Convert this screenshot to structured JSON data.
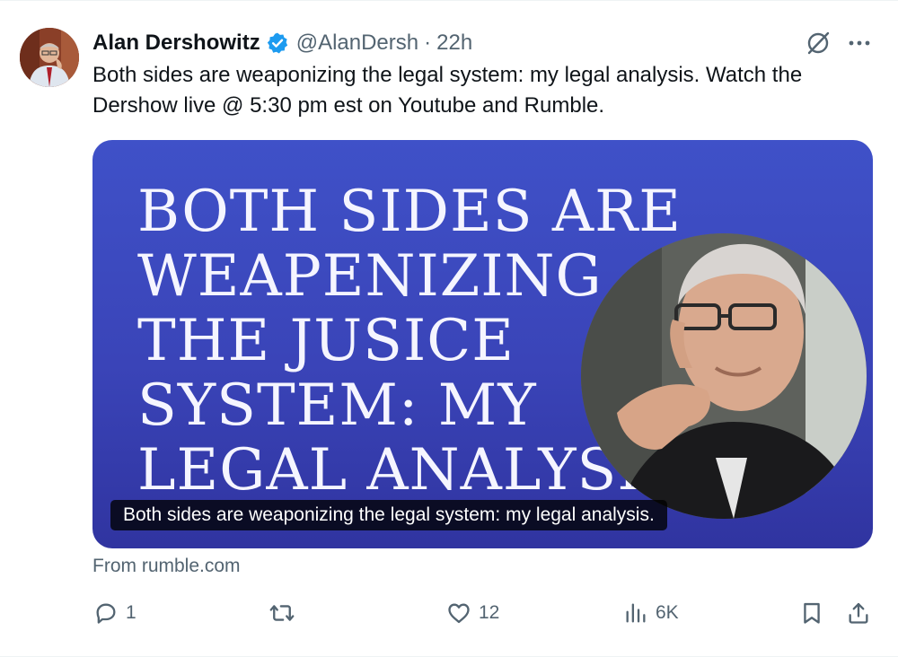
{
  "author": {
    "name": "Alan Dershowitz",
    "handle": "@AlanDersh",
    "separator": "·",
    "time": "22h"
  },
  "tweet": {
    "text": "Both sides are weaponizing the legal system: my legal analysis. Watch the Dershow live @ 5:30 pm est on Youtube and Rumble."
  },
  "card": {
    "title_lines": [
      "BOTH SIDES ARE",
      "WEAPENIZING",
      "THE JUSICE",
      "SYSTEM: MY",
      "LEGAL ANALYSIS."
    ],
    "caption": "Both sides are weaponizing the legal system: my legal analysis.",
    "source": "From rumble.com"
  },
  "actions": {
    "replies": "1",
    "reposts": "",
    "likes": "12",
    "views": "6K"
  },
  "icons": {
    "verified": "verified-badge-icon",
    "grok": "grok-icon",
    "more": "more-icon",
    "reply": "reply-icon",
    "repost": "repost-icon",
    "like": "heart-icon",
    "views": "views-chart-icon",
    "bookmark": "bookmark-icon",
    "share": "share-icon"
  },
  "colors": {
    "verified": "#1d9bf0",
    "secondary_text": "#536471",
    "card_background": "#3f51c8"
  }
}
